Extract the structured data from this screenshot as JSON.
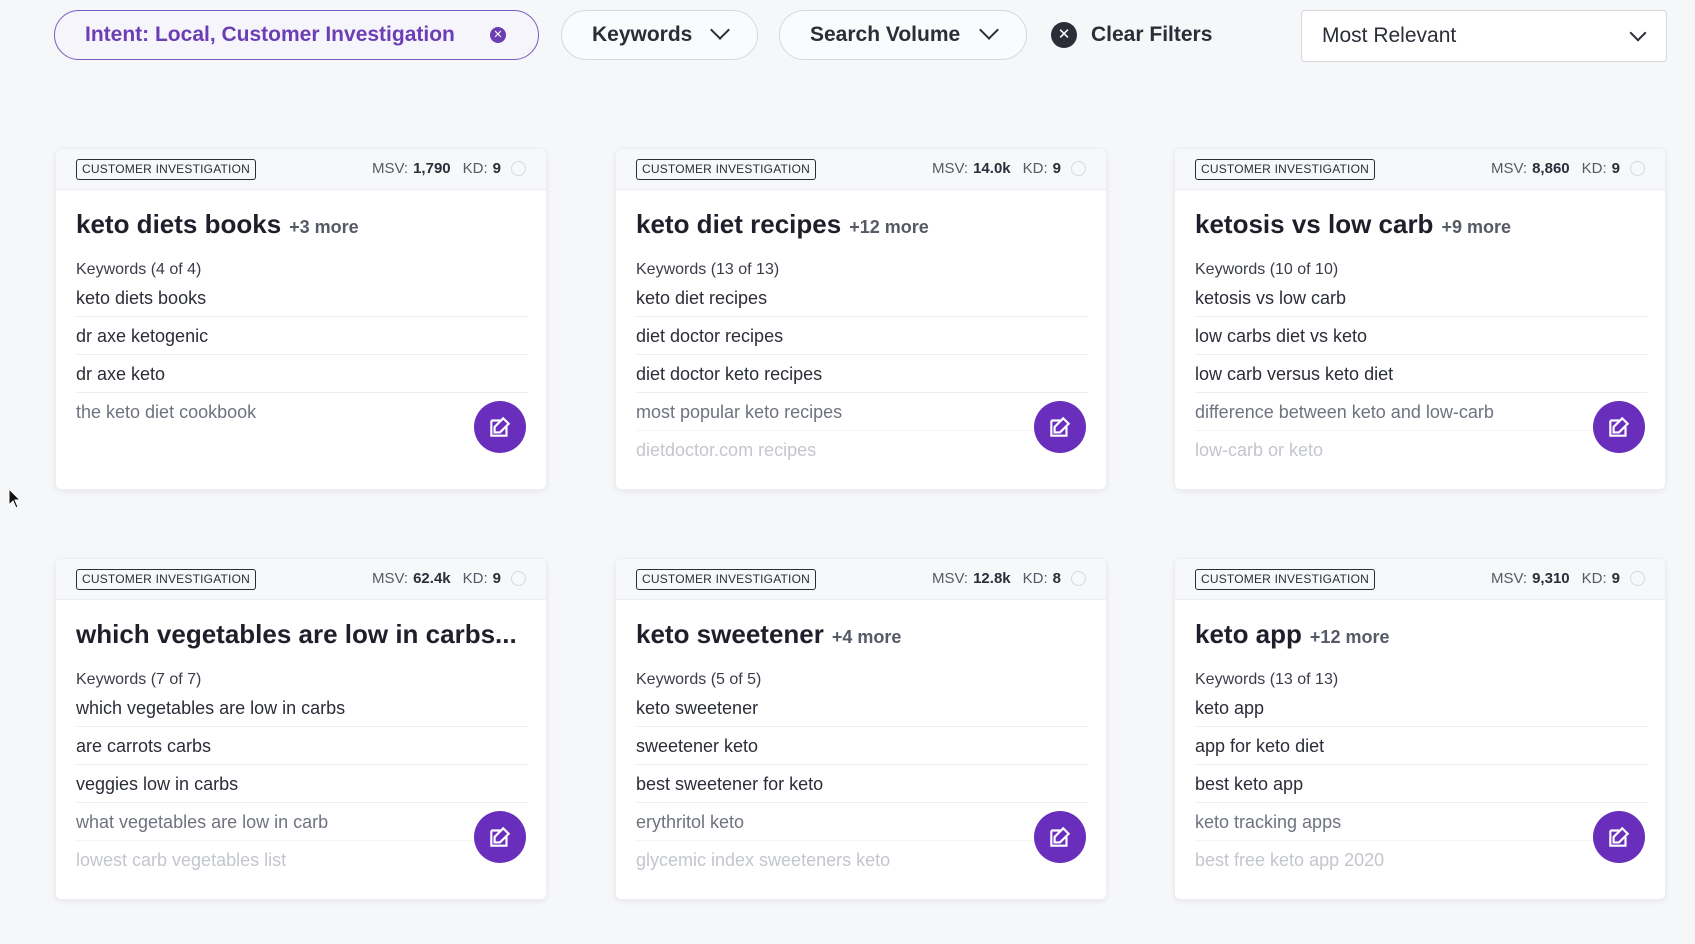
{
  "filters": {
    "intent_label": "Intent: Local, Customer Investigation",
    "keywords_label": "Keywords",
    "search_volume_label": "Search Volume",
    "clear_label": "Clear Filters",
    "sort_value": "Most Relevant"
  },
  "cards": [
    {
      "badge": "CUSTOMER INVESTIGATION",
      "msv_label": "MSV:",
      "msv": "1,790",
      "kd_label": "KD:",
      "kd": "9",
      "title": "keto diets books",
      "more": "+3 more",
      "keywords_count": "Keywords (4 of 4)",
      "keywords": [
        "keto diets books",
        "dr axe ketogenic",
        "dr axe keto",
        "the keto diet cookbook",
        ""
      ]
    },
    {
      "badge": "CUSTOMER INVESTIGATION",
      "msv_label": "MSV:",
      "msv": "14.0k",
      "kd_label": "KD:",
      "kd": "9",
      "title": "keto diet recipes",
      "more": "+12 more",
      "keywords_count": "Keywords (13 of 13)",
      "keywords": [
        "keto diet recipes",
        "diet doctor recipes",
        "diet doctor keto recipes",
        "most popular keto recipes",
        "dietdoctor.com recipes"
      ]
    },
    {
      "badge": "CUSTOMER INVESTIGATION",
      "msv_label": "MSV:",
      "msv": "8,860",
      "kd_label": "KD:",
      "kd": "9",
      "title": "ketosis vs low carb",
      "more": "+9 more",
      "keywords_count": "Keywords (10 of 10)",
      "keywords": [
        "ketosis vs low carb",
        "low carbs diet vs keto",
        "low carb versus keto diet",
        "difference between keto and low-carb",
        "low-carb or keto"
      ]
    },
    {
      "badge": "CUSTOMER INVESTIGATION",
      "msv_label": "MSV:",
      "msv": "62.4k",
      "kd_label": "KD:",
      "kd": "9",
      "title": "which vegetables are low in carbs...",
      "more": "",
      "keywords_count": "Keywords (7 of 7)",
      "keywords": [
        "which vegetables are low in carbs",
        "are carrots carbs",
        "veggies low in carbs",
        "what vegetables are low in carb",
        "lowest carb vegetables list"
      ]
    },
    {
      "badge": "CUSTOMER INVESTIGATION",
      "msv_label": "MSV:",
      "msv": "12.8k",
      "kd_label": "KD:",
      "kd": "8",
      "title": "keto sweetener",
      "more": "+4 more",
      "keywords_count": "Keywords (5 of 5)",
      "keywords": [
        "keto sweetener",
        "sweetener keto",
        "best sweetener for keto",
        "erythritol keto",
        "glycemic index sweeteners keto"
      ]
    },
    {
      "badge": "CUSTOMER INVESTIGATION",
      "msv_label": "MSV:",
      "msv": "9,310",
      "kd_label": "KD:",
      "kd": "9",
      "title": "keto app",
      "more": "+12 more",
      "keywords_count": "Keywords (13 of 13)",
      "keywords": [
        "keto app",
        "app for keto diet",
        "best keto app",
        "keto tracking apps",
        "best free keto app 2020"
      ]
    }
  ],
  "colors": {
    "accent": "#6a2ebc",
    "intent_text": "#6b3fb3"
  },
  "icons": [
    "close-icon",
    "chevron-down-icon",
    "edit-icon",
    "cursor-icon"
  ]
}
